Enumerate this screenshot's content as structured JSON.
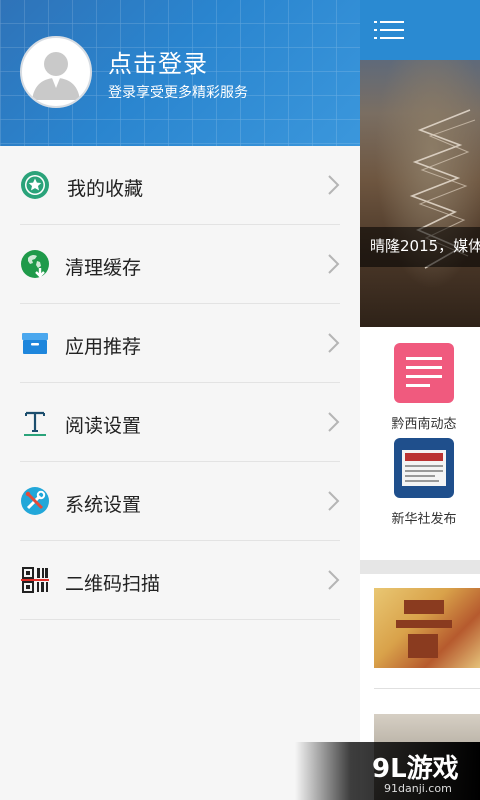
{
  "header": {
    "title": "点击登录",
    "subtitle": "登录享受更多精彩服务"
  },
  "menu": {
    "items": [
      {
        "label": "我的收藏",
        "icon": "star-icon"
      },
      {
        "label": "清理缓存",
        "icon": "clean-cache-icon"
      },
      {
        "label": "应用推荐",
        "icon": "app-box-icon"
      },
      {
        "label": "阅读设置",
        "icon": "text-t-icon"
      },
      {
        "label": "系统设置",
        "icon": "tools-icon"
      },
      {
        "label": "二维码扫描",
        "icon": "qr-code-icon"
      }
    ]
  },
  "main": {
    "banner_caption": "晴隆2015，媒体",
    "apps": [
      {
        "label": "黔西南动态"
      },
      {
        "label": "新华社发布"
      }
    ]
  },
  "watermark": {
    "text": "9L游戏",
    "url": "91danji.com"
  },
  "colors": {
    "header_blue": "#2a85cf",
    "topbar_blue": "#2a8ad2",
    "star_green": "#2aa37a",
    "tools_blue": "#22a7d9",
    "app_pink": "#f05a7e",
    "app_navy": "#1f4f8c"
  }
}
